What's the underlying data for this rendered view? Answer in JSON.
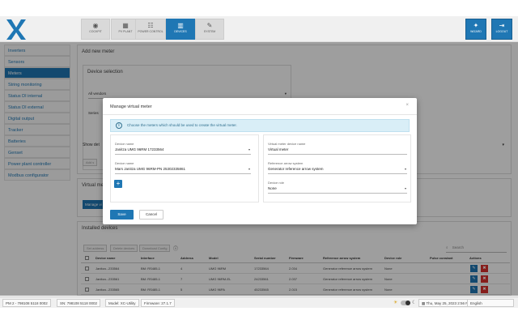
{
  "nav": {
    "tabs": [
      {
        "label": "COCKPIT",
        "icon": "gauge-icon"
      },
      {
        "label": "PV PLANT",
        "icon": "solar-panel-icon"
      },
      {
        "label": "POWER CONTROL",
        "icon": "power-control-icon"
      },
      {
        "label": "DEVICES",
        "icon": "devices-icon"
      },
      {
        "label": "SYSTEM",
        "icon": "wrench-icon"
      }
    ],
    "wizard_label": "WIZARD",
    "logout_label": "LOGOUT"
  },
  "sidebar": {
    "items": [
      {
        "label": "Inverters"
      },
      {
        "label": "Sensors"
      },
      {
        "label": "Meters"
      },
      {
        "label": "String monitoring"
      },
      {
        "label": "Status DI internal"
      },
      {
        "label": "Status DI external"
      },
      {
        "label": "Digital output"
      },
      {
        "label": "Tracker"
      },
      {
        "label": "Batteries"
      },
      {
        "label": "Genset"
      },
      {
        "label": "Power plant controller"
      },
      {
        "label": "Modbus configurator"
      }
    ],
    "active_index": 2
  },
  "main": {
    "add_meter_title": "Add new meter",
    "device_selection_title": "Device selection",
    "vendor_value": "All vendors",
    "series_label": "Series",
    "show_details_label": "Show det",
    "virtual_meter_title": "Virtual mete",
    "manage_virtual_label": "Manage vi",
    "installed_title": "Installed devices",
    "toolbar": {
      "set_addr_label": "Set address",
      "delete_label": "Delete devices",
      "download_label": "Download Config",
      "search_placeholder": "Search"
    }
  },
  "table": {
    "headers": [
      "Device name",
      "Interface",
      "Address",
      "Model",
      "Serial number",
      "Firmware",
      "Reference arrow system",
      "Device role",
      "Pulse constant",
      "Actions"
    ],
    "rows": [
      [
        "Janitza...233564",
        "BM: RS485-1",
        "4",
        "UMG 96RM",
        "17233564",
        "2.034",
        "Generator reference arrow system",
        "None",
        ""
      ],
      [
        "Janitza...233561",
        "BM: RS485-1",
        "7",
        "UMG 96RM-EL",
        "24233561",
        "2.037",
        "Generator reference arrow system",
        "None",
        ""
      ],
      [
        "Janitza...233565",
        "BM: RS485-1",
        "5",
        "UMG 96PA",
        "45233565",
        "2.015",
        "Generator reference arrow system",
        "None",
        ""
      ]
    ]
  },
  "modal": {
    "title": "Manage virtual meter",
    "info_text": "Choose the meters which should be used to create the virtual meter.",
    "device1_label": "Device name",
    "device1_value": "Janitza UMG 96RM 17233564",
    "device2_label": "Device name",
    "device2_value": "Mars Janitza UMG 96RM-PN 25302335861",
    "vm_name_label": "Virtual meter device name",
    "vm_name_value": "Virtual meter",
    "ref_arrow_label": "Reference arrow system",
    "ref_arrow_value": "Generator reference arrow system",
    "device_role_label": "Device role",
    "device_role_value": "None",
    "save_label": "Save",
    "cancel_label": "Cancel"
  },
  "status": {
    "pm": "PM 2 - 798108 5118 0002",
    "sn": "SN: 798108 5118 0002",
    "model": "Model: XC-Utility",
    "firmware": "Firmware: 27.1.7",
    "datetime": "Thu, May 25, 2023 2:56 PM",
    "language": "English"
  },
  "colors": {
    "accent": "#1f77b4",
    "danger": "#d9302c",
    "info_bg": "#d9eef7"
  }
}
